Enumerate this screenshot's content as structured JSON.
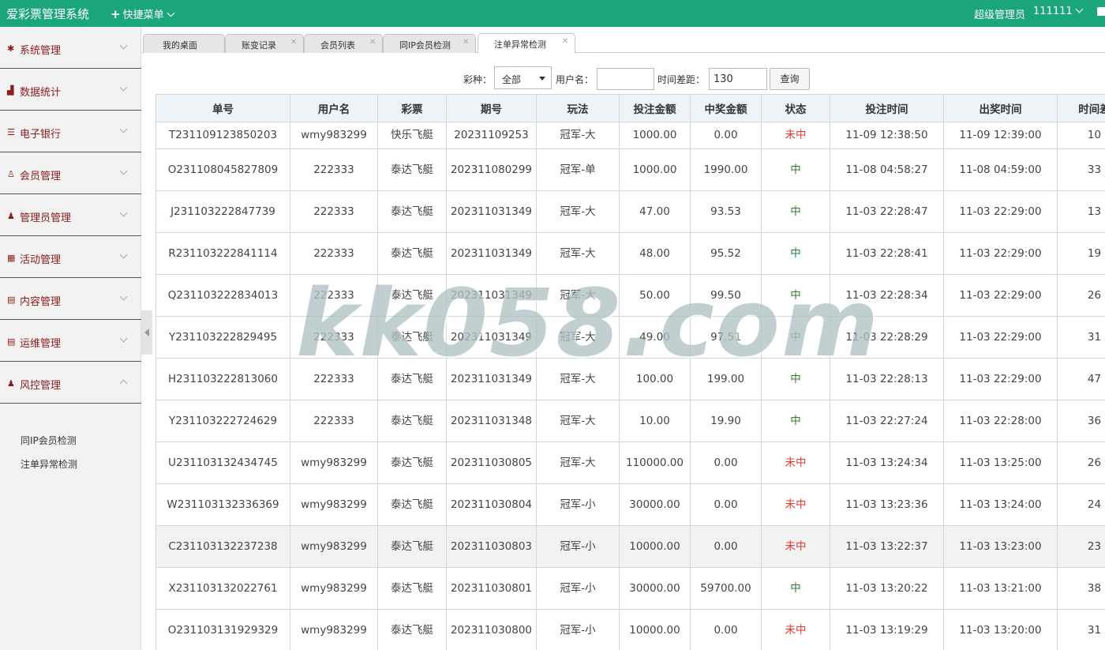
{
  "header": {
    "brand": "爱彩票管理系统",
    "quick_menu": "快捷菜单",
    "role": "超级管理员",
    "username": "111111"
  },
  "sidebar": {
    "items": [
      {
        "icon": "gear-icon",
        "glyph": "✱",
        "label": "系统管理"
      },
      {
        "icon": "bar-chart-icon",
        "glyph": "▟",
        "label": "数据统计"
      },
      {
        "icon": "list-icon",
        "glyph": "☰",
        "label": "电子银行"
      },
      {
        "icon": "user-outline-icon",
        "glyph": "♙",
        "label": "会员管理"
      },
      {
        "icon": "user-icon",
        "glyph": "♟",
        "label": "管理员管理"
      },
      {
        "icon": "calendar-icon",
        "glyph": "▦",
        "label": "活动管理"
      },
      {
        "icon": "document-icon",
        "glyph": "▤",
        "label": "内容管理"
      },
      {
        "icon": "document-icon",
        "glyph": "▤",
        "label": "运维管理"
      },
      {
        "icon": "user-icon",
        "glyph": "♟",
        "label": "风控管理"
      }
    ],
    "sub_items": [
      "同IP会员检测",
      "注单异常检测"
    ]
  },
  "tabs": [
    {
      "label": "我的桌面",
      "closable": false
    },
    {
      "label": "账变记录",
      "closable": true
    },
    {
      "label": "会员列表",
      "closable": true
    },
    {
      "label": "同IP会员检测",
      "closable": true
    },
    {
      "label": "注单异常检测",
      "closable": true,
      "active": true
    }
  ],
  "filter": {
    "lottery_label": "彩种：",
    "lottery_value": "全部",
    "username_label": "用户名：",
    "username_value": "",
    "timediff_label": "时间差距：",
    "timediff_value": "130",
    "query_button": "查询"
  },
  "table": {
    "headers": [
      "单号",
      "用户名",
      "彩票",
      "期号",
      "玩法",
      "投注金额",
      "中奖金额",
      "状态",
      "投注时间",
      "出奖时间",
      "时间差"
    ],
    "rows": [
      [
        "T231109123850203",
        "wmy983299",
        "快乐飞艇",
        "20231109253",
        "冠军-大",
        "1000.00",
        "0.00",
        "未中",
        "11-09 12:38:50",
        "11-09 12:39:00",
        "10"
      ],
      [
        "O231108045827809",
        "222333",
        "泰达飞艇",
        "202311080299",
        "冠军-单",
        "1000.00",
        "1990.00",
        "中",
        "11-08 04:58:27",
        "11-08 04:59:00",
        "33"
      ],
      [
        "J231103222847739",
        "222333",
        "泰达飞艇",
        "202311031349",
        "冠军-大",
        "47.00",
        "93.53",
        "中",
        "11-03 22:28:47",
        "11-03 22:29:00",
        "13"
      ],
      [
        "R231103222841114",
        "222333",
        "泰达飞艇",
        "202311031349",
        "冠军-大",
        "48.00",
        "95.52",
        "中",
        "11-03 22:28:41",
        "11-03 22:29:00",
        "19"
      ],
      [
        "Q231103222834013",
        "222333",
        "泰达飞艇",
        "202311031349",
        "冠军-大",
        "50.00",
        "99.50",
        "中",
        "11-03 22:28:34",
        "11-03 22:29:00",
        "26"
      ],
      [
        "Y231103222829495",
        "222333",
        "泰达飞艇",
        "202311031349",
        "冠军-大",
        "49.00",
        "97.51",
        "中",
        "11-03 22:28:29",
        "11-03 22:29:00",
        "31"
      ],
      [
        "H231103222813060",
        "222333",
        "泰达飞艇",
        "202311031349",
        "冠军-大",
        "100.00",
        "199.00",
        "中",
        "11-03 22:28:13",
        "11-03 22:29:00",
        "47"
      ],
      [
        "Y231103222724629",
        "222333",
        "泰达飞艇",
        "202311031348",
        "冠军-大",
        "10.00",
        "19.90",
        "中",
        "11-03 22:27:24",
        "11-03 22:28:00",
        "36"
      ],
      [
        "U231103132434745",
        "wmy983299",
        "泰达飞艇",
        "202311030805",
        "冠军-大",
        "110000.00",
        "0.00",
        "未中",
        "11-03 13:24:34",
        "11-03 13:25:00",
        "26"
      ],
      [
        "W231103132336369",
        "wmy983299",
        "泰达飞艇",
        "202311030804",
        "冠军-小",
        "30000.00",
        "0.00",
        "未中",
        "11-03 13:23:36",
        "11-03 13:24:00",
        "24"
      ],
      [
        "C231103132237238",
        "wmy983299",
        "泰达飞艇",
        "202311030803",
        "冠军-小",
        "10000.00",
        "0.00",
        "未中",
        "11-03 13:22:37",
        "11-03 13:23:00",
        "23"
      ],
      [
        "X231103132022761",
        "wmy983299",
        "泰达飞艇",
        "202311030801",
        "冠军-小",
        "30000.00",
        "59700.00",
        "中",
        "11-03 13:20:22",
        "11-03 13:21:00",
        "38"
      ],
      [
        "O231103131929329",
        "wmy983299",
        "泰达飞艇",
        "202311030800",
        "冠军-小",
        "10000.00",
        "0.00",
        "未中",
        "11-03 13:19:29",
        "11-03 13:20:00",
        "31"
      ]
    ]
  },
  "watermark": "kk058.com",
  "colors": {
    "header_bg": "#1aa57a",
    "menu_text": "#8b1a1a",
    "win": "#2e7d32",
    "lose": "#e53935"
  }
}
